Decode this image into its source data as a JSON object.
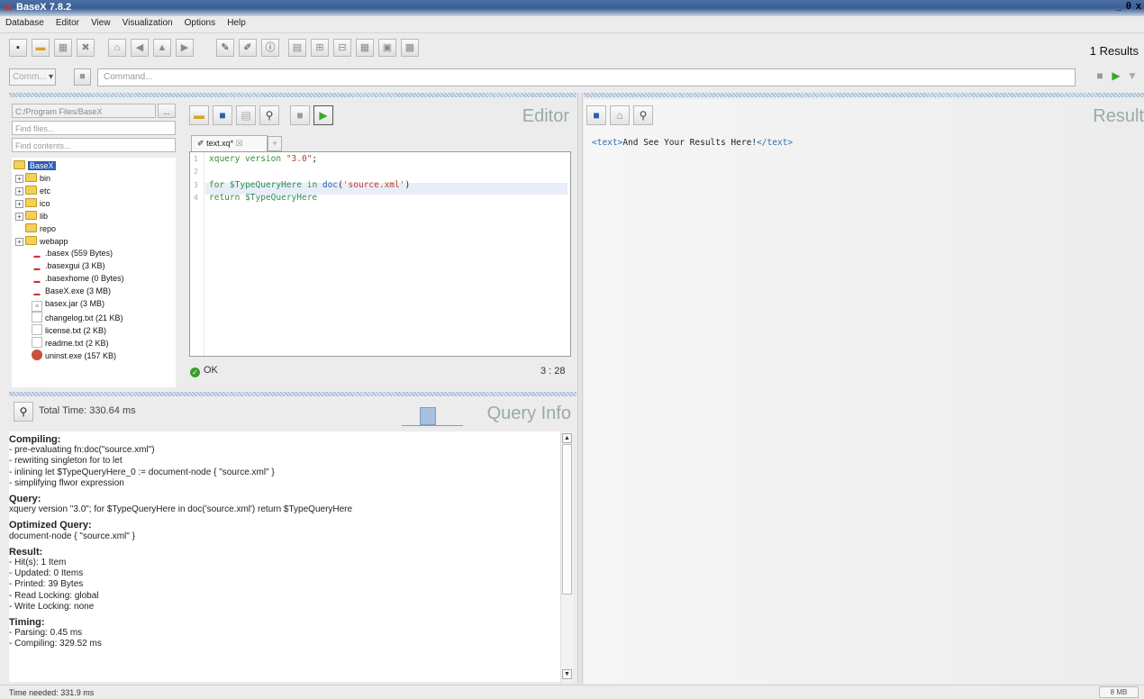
{
  "window": {
    "title": "BaseX 7.8.2",
    "controls": "_ θ x"
  },
  "menu": [
    "Database",
    "Editor",
    "View",
    "Visualization",
    "Options",
    "Help"
  ],
  "toolbar": {
    "results_count": "1 Results"
  },
  "command": {
    "mode": "Comm...",
    "placeholder": "Command..."
  },
  "project": {
    "path": "C:/Program Files/BaseX",
    "path_button": "...",
    "find_files_placeholder": "Find files...",
    "find_contents_placeholder": "Find contents...",
    "root": "BaseX",
    "folders": [
      "bin",
      "etc",
      "ico",
      "lib",
      "repo",
      "webapp"
    ],
    "files": [
      ".basex (559 Bytes)",
      ".basexgui (3 KB)",
      ".basexhome (0 Bytes)",
      "BaseX.exe (3 MB)",
      "basex.jar (3 MB)",
      "changelog.txt (21 KB)",
      "license.txt (2 KB)",
      "readme.txt (2 KB)",
      "uninst.exe (157 KB)"
    ]
  },
  "editor": {
    "title": "Editor",
    "tab_label": "text.xq*",
    "line_numbers": [
      "1",
      "2",
      "3",
      "4"
    ],
    "status": "OK",
    "cursor": "3 : 28"
  },
  "query_info": {
    "title": "Query Info",
    "total_time": "Total Time: 330.64 ms",
    "compiling_header": "Compiling:",
    "compiling": [
      "- pre-evaluating fn:doc(\"source.xml\")",
      "- rewriting singleton for to let",
      "- inlining let $TypeQueryHere_0 := document-node { \"source.xml\" }",
      "- simplifying flwor expression"
    ],
    "query_header": "Query:",
    "query": "xquery version \"3.0\"; for $TypeQueryHere in doc('source.xml') return $TypeQueryHere",
    "optimized_header": "Optimized Query:",
    "optimized": "document-node { \"source.xml\" }",
    "result_header": "Result:",
    "result": [
      "- Hit(s): 1 Item",
      "- Updated: 0 Items",
      "- Printed: 39 Bytes",
      "- Read Locking: global",
      "- Write Locking: none"
    ],
    "timing_header": "Timing:",
    "timing": [
      "- Parsing: 0.45 ms",
      "- Compiling: 329.52 ms"
    ]
  },
  "result": {
    "title": "Result",
    "text": "And See Your Results Here!"
  },
  "statusbar": {
    "message": "Time needed: 331.9 ms",
    "memory": "8 MB"
  }
}
